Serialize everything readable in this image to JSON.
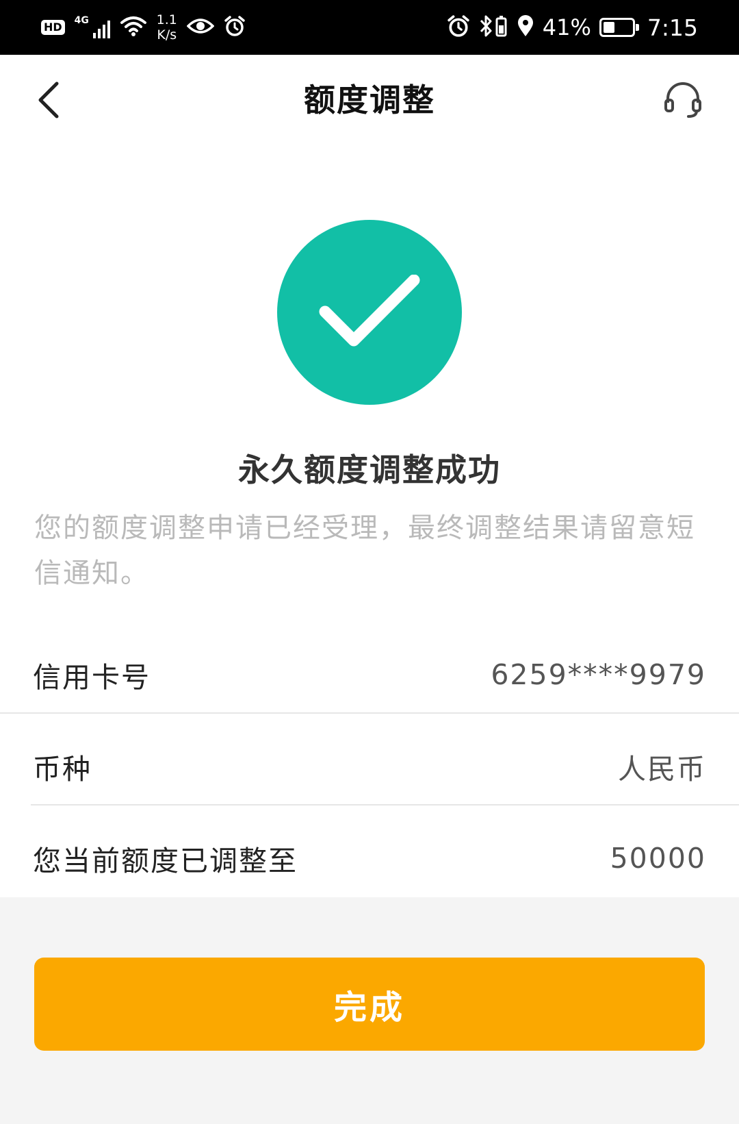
{
  "status_bar": {
    "hd": "HD",
    "network": "4G",
    "speed_value": "1.1",
    "speed_unit": "K/s",
    "battery_percent": "41%",
    "battery_level": 0.41,
    "time": "7:15"
  },
  "header": {
    "title": "额度调整",
    "back_icon": "chevron-left-icon",
    "service_icon": "headset-icon"
  },
  "result": {
    "icon": "check-circle-icon",
    "icon_color": "#12bfa6",
    "title": "永久额度调整成功",
    "description": "您的额度调整申请已经受理，最终调整结果请留意短信通知。"
  },
  "details": {
    "card_label": "信用卡号",
    "card_value": "6259****9979",
    "currency_label": "币种",
    "currency_value": "人民币",
    "limit_label": "您当前额度已调整至",
    "limit_value": "50000"
  },
  "actions": {
    "done_label": "完成",
    "done_color": "#fba800"
  }
}
